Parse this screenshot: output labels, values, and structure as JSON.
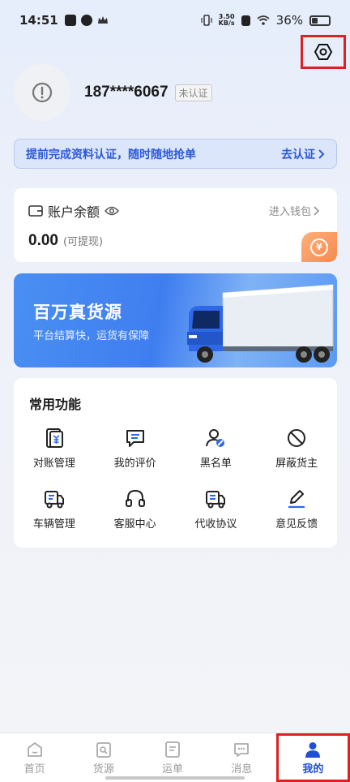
{
  "status_bar": {
    "time": "14:51",
    "net_speed_value": "3.50",
    "net_speed_unit": "KB/s",
    "battery_percent": "36%",
    "battery_level": 0.36
  },
  "profile": {
    "phone": "187****6067",
    "verify_status": "未认证"
  },
  "notice": {
    "text": "提前完成资料认证，随时随地抢单",
    "action": "去认证"
  },
  "wallet": {
    "title": "账户余额",
    "enter_label": "进入钱包",
    "amount": "0.00",
    "amount_note": "(可提现)",
    "coin_symbol": "¥"
  },
  "banner": {
    "slogan": "百万真货源",
    "subtitle": "平台结算快，运货有保障"
  },
  "functions": {
    "title": "常用功能",
    "items": [
      {
        "label": "对账管理",
        "icon": "ledger-icon"
      },
      {
        "label": "我的评价",
        "icon": "comment-icon"
      },
      {
        "label": "黑名单",
        "icon": "blacklist-user-icon"
      },
      {
        "label": "屏蔽货主",
        "icon": "block-icon"
      },
      {
        "label": "车辆管理",
        "icon": "truck-icon"
      },
      {
        "label": "客服中心",
        "icon": "headset-icon"
      },
      {
        "label": "代收协议",
        "icon": "agreement-icon"
      },
      {
        "label": "意见反馈",
        "icon": "edit-pen-icon"
      }
    ]
  },
  "tabbar": {
    "tabs": [
      {
        "label": "首页",
        "icon": "home-icon"
      },
      {
        "label": "货源",
        "icon": "cargo-search-icon"
      },
      {
        "label": "运单",
        "icon": "waybill-icon"
      },
      {
        "label": "消息",
        "icon": "message-icon"
      },
      {
        "label": "我的",
        "icon": "user-icon",
        "active": true
      }
    ]
  },
  "colors": {
    "accent": "#1f4fd6",
    "notice_text": "#2d5ad6",
    "highlight_box": "#e02020",
    "banner_blue": "#4a8ff2",
    "coin_orange": "#f58a4f"
  }
}
